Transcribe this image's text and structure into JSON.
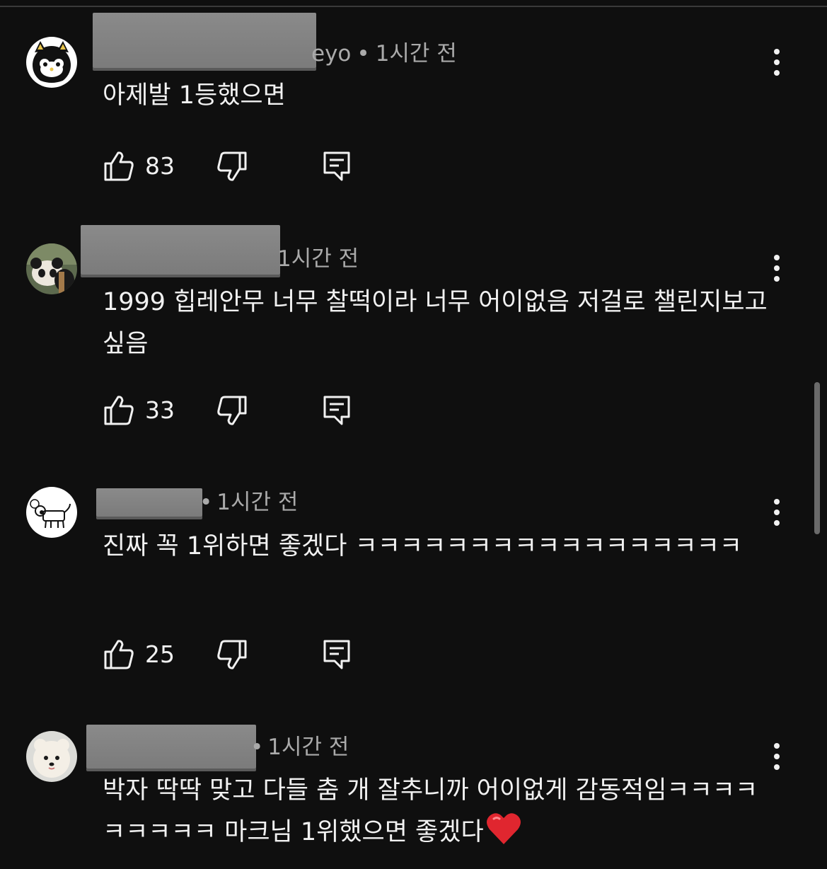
{
  "comments": [
    {
      "author_visible_suffix": "eyo",
      "separator": "•",
      "time": "1시간 전",
      "text": "아제발 1등했으면",
      "likes": "83"
    },
    {
      "author_visible_suffix": "",
      "separator": "",
      "time": "1시간 전",
      "text": "1999 힙레안무 너무 찰떡이라 너무 어이없음 저걸로 챌린지보고싶음",
      "likes": "33"
    },
    {
      "author_visible_suffix": "",
      "separator": "•",
      "time": "1시간 전",
      "text": "진짜 꼭 1위하면 좋겠다 ㅋㅋㅋㅋㅋㅋㅋㅋㅋㅋㅋㅋㅋㅋㅋㅋㅋ",
      "likes": "25"
    },
    {
      "author_visible_suffix": "",
      "separator": "•",
      "time": "1시간 전",
      "text": "박자 딱딱 맞고 다들 춤 개 잘추니까 어이없게 감동적임ㅋㅋㅋㅋㅋㅋㅋㅋㅋ 마크님 1위했으면 좋겠다",
      "likes": ""
    }
  ],
  "icons": {
    "like": "thumbs-up-icon",
    "dislike": "thumbs-down-icon",
    "reply": "reply-comment-icon",
    "more": "more-vertical-icon",
    "emoji": "red-heart-emoji"
  },
  "colors": {
    "background": "#0f0f0f",
    "text": "#f1f1f1",
    "meta": "#aaaaaa",
    "heart": "#e0262f"
  }
}
